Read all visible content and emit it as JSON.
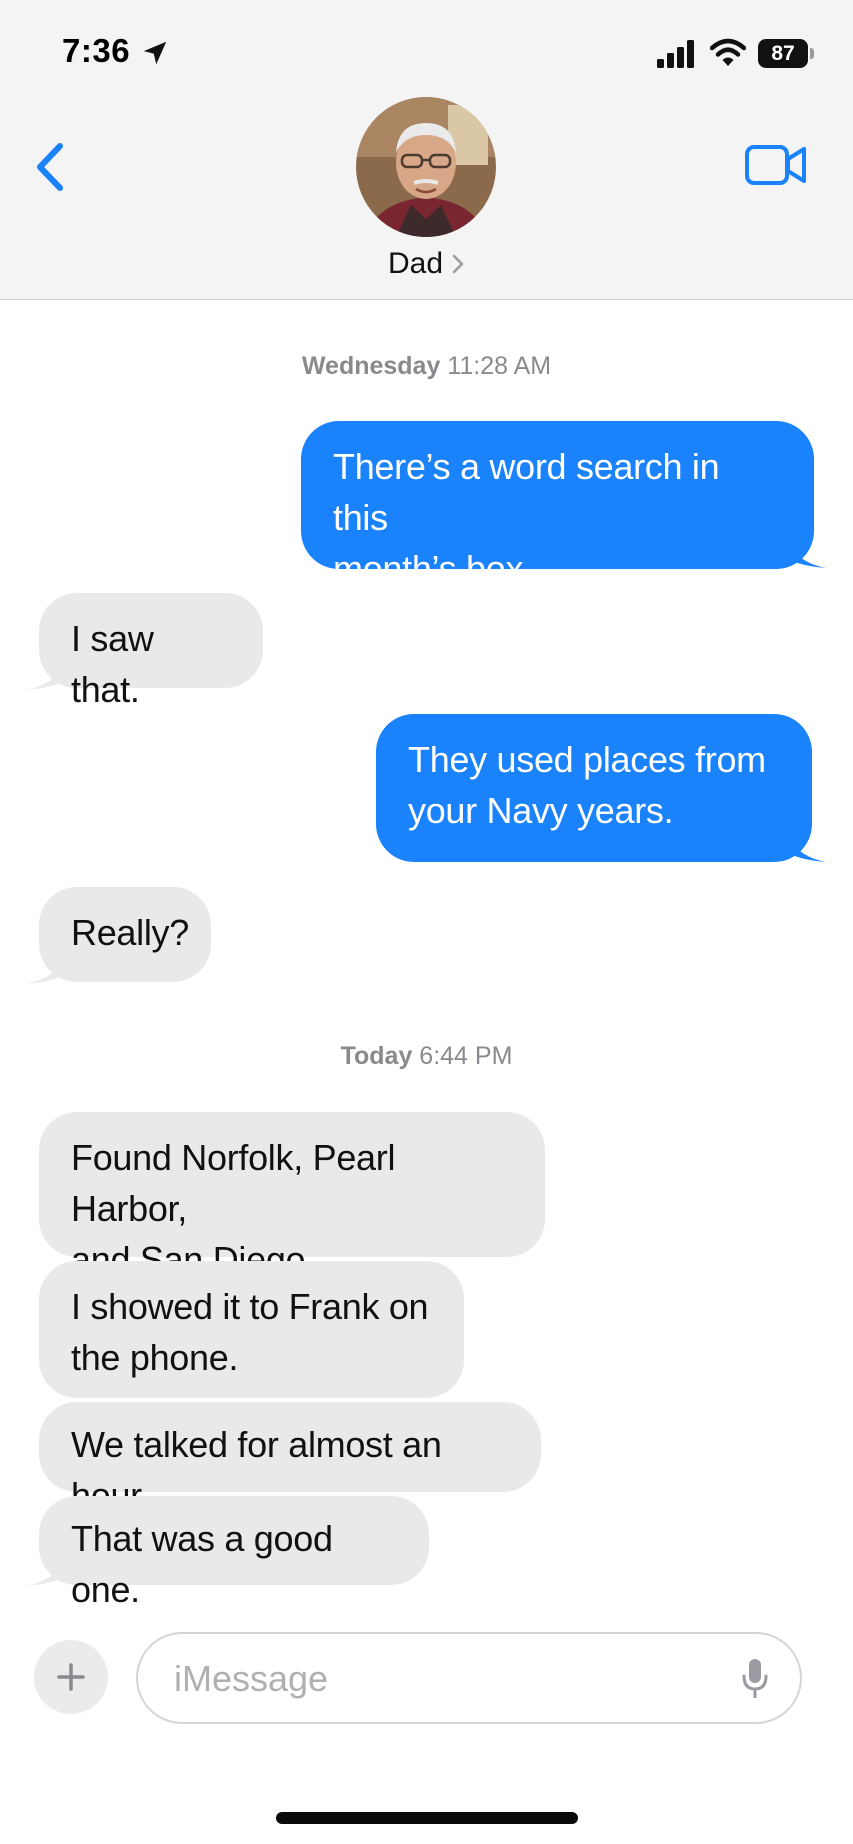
{
  "status_bar": {
    "time": "7:36",
    "battery": "87"
  },
  "header": {
    "contact_name": "Dad",
    "back_icon": "chevron-left-icon",
    "video_icon": "video-camera-icon"
  },
  "conversation": {
    "timestamps": [
      {
        "day": "Wednesday",
        "time": "11:28 AM"
      },
      {
        "day": "Today",
        "time": "6:44 PM"
      }
    ],
    "messages": [
      {
        "direction": "out",
        "lines": [
          "There’s a word search in this",
          "month’s box."
        ]
      },
      {
        "direction": "in",
        "lines": [
          "I saw that."
        ]
      },
      {
        "direction": "out",
        "lines": [
          "They used places from",
          "your Navy years."
        ]
      },
      {
        "direction": "in",
        "lines": [
          "Really?"
        ]
      },
      {
        "direction": "in",
        "lines": [
          "Found Norfolk, Pearl Harbor,",
          "and San Diego."
        ]
      },
      {
        "direction": "in",
        "lines": [
          "I showed it to Frank on",
          "the phone."
        ]
      },
      {
        "direction": "in",
        "lines": [
          "We talked for almost an hour."
        ]
      },
      {
        "direction": "in",
        "lines": [
          "That was a good one."
        ]
      }
    ]
  },
  "composer": {
    "placeholder": "iMessage",
    "value": ""
  },
  "colors": {
    "accent": "#1a82fb",
    "incoming_bubble": "#e9e9eb",
    "header_bg": "#f4f4f5"
  }
}
